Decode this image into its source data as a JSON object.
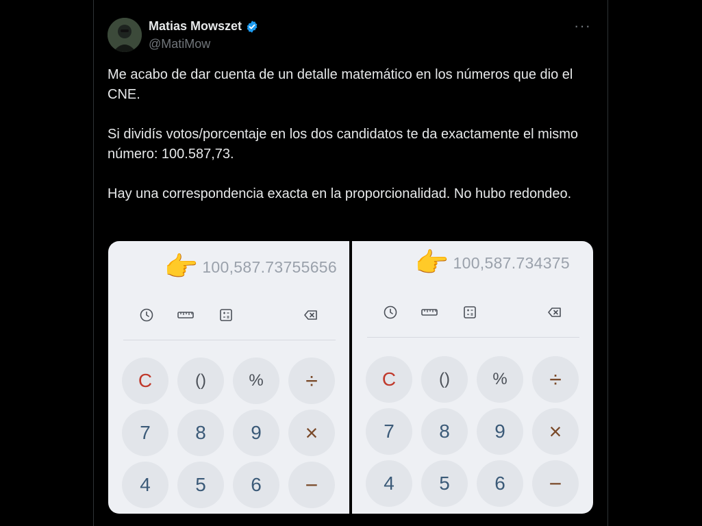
{
  "author": {
    "display_name": "Matias Mowszet",
    "handle": "@MatiMow",
    "verified": true
  },
  "more_label": "···",
  "tweet": {
    "paragraphs": [
      "Me acabo de dar cuenta de un detalle matemático en los números que dio el CNE.",
      "Si dividís votos/porcentaje en los dos candidatos te da exactamente el mismo número: 100.587,73.",
      "Hay una correspondencia exacta en la proporcionalidad. No hubo redondeo."
    ]
  },
  "media": {
    "left": {
      "emoji": "👉",
      "result": "100,587.73755656"
    },
    "right": {
      "emoji": "👉",
      "result": "100,587.734375"
    },
    "keys": [
      {
        "label": "C",
        "style": "red"
      },
      {
        "label": "()",
        "style": "gray"
      },
      {
        "label": "%",
        "style": "gray"
      },
      {
        "label": "÷",
        "style": "op"
      },
      {
        "label": "7",
        "style": "num"
      },
      {
        "label": "8",
        "style": "num"
      },
      {
        "label": "9",
        "style": "num"
      },
      {
        "label": "×",
        "style": "op"
      },
      {
        "label": "4",
        "style": "num"
      },
      {
        "label": "5",
        "style": "num"
      },
      {
        "label": "6",
        "style": "num"
      },
      {
        "label": "−",
        "style": "op"
      }
    ]
  },
  "colors": {
    "background": "#000000",
    "text": "#e7e9ea",
    "muted": "#71767b",
    "verified": "#1d9bf0",
    "calc_bg": "#eef0f4"
  },
  "icons": [
    "history-icon",
    "ruler-icon",
    "calculator-icon",
    "backspace-icon",
    "verified-badge-icon"
  ]
}
